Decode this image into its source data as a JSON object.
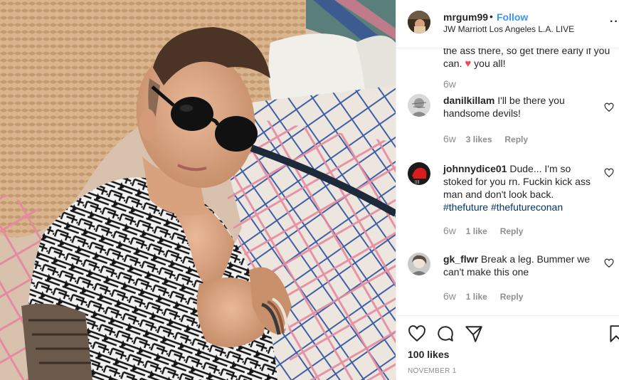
{
  "header": {
    "username": "mrgum99",
    "separator": "•",
    "follow_label": "Follow",
    "location": "JW Marriott Los Angeles L.A. LIVE",
    "more_label": "··"
  },
  "caption": {
    "text_line_partial": "the ass there, so get there early if you",
    "text_end_before_heart": "can.",
    "heart": "♥",
    "text_end_after_heart": "you all!",
    "time": "6w"
  },
  "comments": [
    {
      "username": "danilkillam",
      "text": "I'll be there you handsome devils!",
      "hashtags": "",
      "time": "6w",
      "likes": "3 likes",
      "reply_label": "Reply"
    },
    {
      "username": "johnnydice01",
      "text": "Dude... I'm so stoked for you rn. Fuckin kick ass man and don't look back.",
      "hashtags": "#thefuture #thefutureconan",
      "time": "6w",
      "likes": "1 like",
      "reply_label": "Reply"
    },
    {
      "username": "gk_flwr",
      "text": "Break a leg. Bummer we can't make this one",
      "hashtags": "",
      "time": "6w",
      "likes": "1 like",
      "reply_label": "Reply"
    }
  ],
  "footer": {
    "likes_count": "100 likes",
    "date": "NOVEMBER 1"
  },
  "icons": {
    "like": "heart-outline-icon",
    "comment": "speech-bubble-icon",
    "share": "paper-plane-icon",
    "save": "bookmark-icon",
    "more": "more-options-icon"
  },
  "colors": {
    "follow_blue": "#3897f0",
    "hashtag_blue": "#003569",
    "muted_gray": "#8e8e8e",
    "heart_red": "#ed4956",
    "text_dark": "#262626"
  }
}
